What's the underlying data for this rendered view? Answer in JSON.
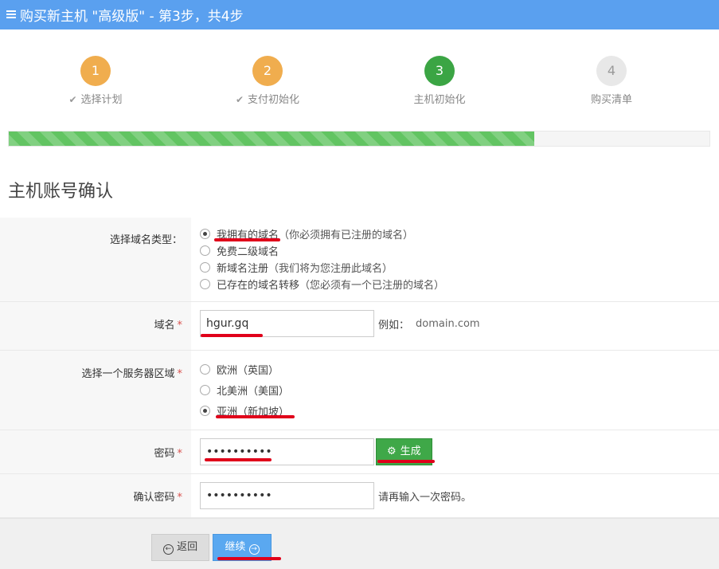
{
  "window": {
    "title": "购买新主机 \"高级版\" - 第3步，共4步",
    "accent": "#5aa0ef"
  },
  "steps": [
    {
      "number": "1",
      "label": "选择计划",
      "done": true,
      "color": "#f0ad4e"
    },
    {
      "number": "2",
      "label": "支付初始化",
      "done": true,
      "color": "#f0ad4e"
    },
    {
      "number": "3",
      "label": "主机初始化",
      "done": false,
      "color": "#3ba544"
    },
    {
      "number": "4",
      "label": "购买清单",
      "done": false,
      "color": "#e8e8e8"
    }
  ],
  "progress": {
    "percent": 75,
    "color": "#62c462"
  },
  "section": {
    "title": "主机账号确认"
  },
  "form": {
    "domain_type": {
      "label": "选择域名类型：",
      "options": [
        {
          "text": "我拥有的域名",
          "note": "（你必须拥有已注册的域名）",
          "selected": true
        },
        {
          "text": "免费二级域名",
          "note": "",
          "selected": false
        },
        {
          "text": "新域名注册",
          "note": "（我们将为您注册此域名）",
          "selected": false
        },
        {
          "text": "已存在的域名转移",
          "note": "（您必须有一个已注册的域名）",
          "selected": false
        }
      ]
    },
    "domain": {
      "label": "域名",
      "required": "*",
      "value": "hgur.gq",
      "example_label": "例如：",
      "example_value": "domain.com"
    },
    "region": {
      "label": "选择一个服务器区域",
      "required": "*",
      "options": [
        {
          "text": "欧洲（英国）",
          "selected": false
        },
        {
          "text": "北美洲（美国）",
          "selected": false
        },
        {
          "text": "亚洲（新加坡）",
          "selected": true
        }
      ]
    },
    "password": {
      "label": "密码",
      "required": "*",
      "value": "••••••••••",
      "generate_label": "生成",
      "generate_icon": "gear-icon"
    },
    "confirm": {
      "label": "确认密码",
      "required": "*",
      "value": "••••••••••",
      "hint": "请再输入一次密码。"
    }
  },
  "footer": {
    "back_label": "返回",
    "back_icon": "arrow-left-circle-icon",
    "next_label": "继续",
    "next_icon": "arrow-right-circle-icon"
  },
  "annotations": {
    "color": "#e0001a"
  }
}
